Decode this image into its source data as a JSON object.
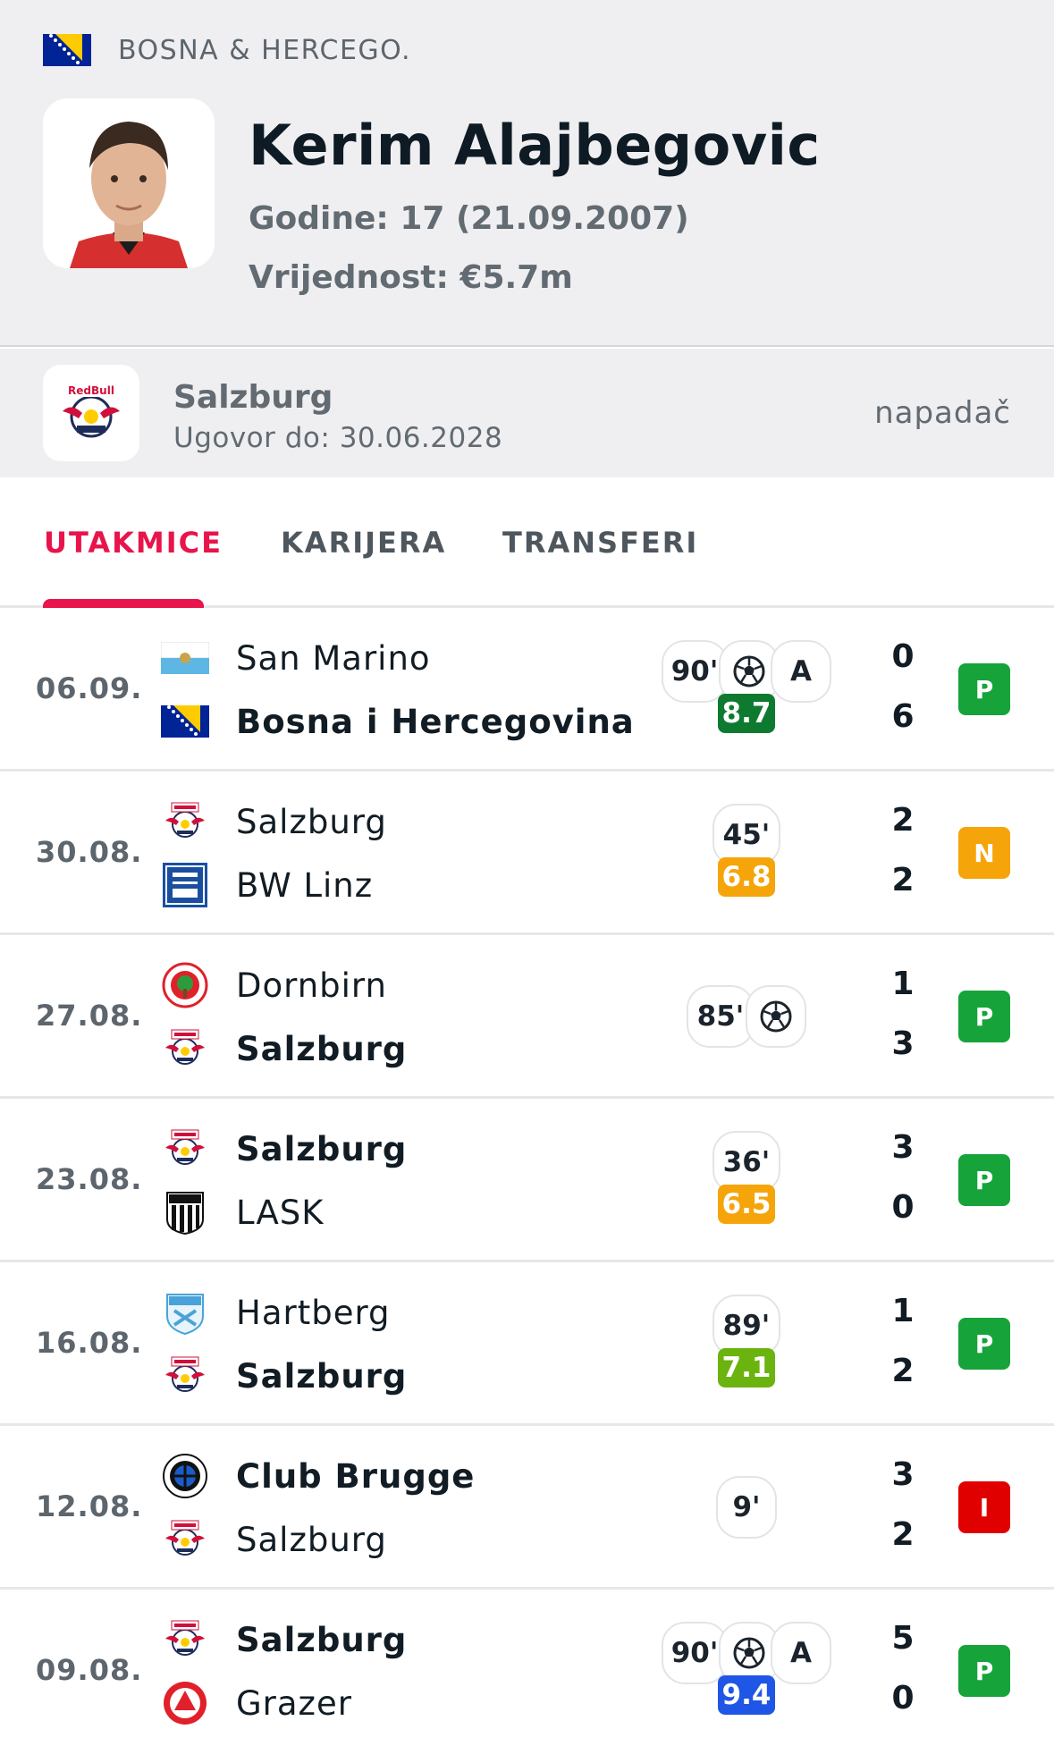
{
  "colors": {
    "accent": "#e8144b",
    "win": "#16a33a",
    "draw": "#f5a50a",
    "loss": "#e00000",
    "rating_dark_green": "#0e7a2f",
    "rating_orange": "#f5a50a",
    "rating_light_green": "#6bb30f",
    "rating_blue": "#1f56e6"
  },
  "header": {
    "country": "BOSNA & HERCEGO.",
    "country_flag": "bosnia-flag",
    "player_name": "Kerim Alajbegovic",
    "age_line": "Godine: 17 (21.09.2007)",
    "value_line": "Vrijednost: €5.7m"
  },
  "club": {
    "name": "Salzburg",
    "contract": "Ugovor do: 30.06.2028",
    "position": "napadač",
    "logo": "salzburg-logo"
  },
  "tabs": [
    {
      "label": "UTAKMICE",
      "active": true
    },
    {
      "label": "KARIJERA",
      "active": false
    },
    {
      "label": "TRANSFERI",
      "active": false
    }
  ],
  "matches": [
    {
      "date": "06.09.",
      "home": "San Marino",
      "home_logo": "san-marino-flag",
      "away": "Bosna i Hercegovina",
      "away_logo": "bosnia-flag",
      "bold": "away",
      "minutes": "90'",
      "goal": true,
      "assist": "A",
      "rating": "8.7",
      "rating_color": "#0e7a2f",
      "home_score": "0",
      "away_score": "6",
      "result": "P",
      "result_color": "#16a33a"
    },
    {
      "date": "30.08.",
      "home": "Salzburg",
      "home_logo": "salzburg-logo",
      "away": "BW Linz",
      "away_logo": "bw-linz-logo",
      "bold": "none",
      "minutes": "45'",
      "goal": false,
      "assist": "",
      "rating": "6.8",
      "rating_color": "#f5a50a",
      "home_score": "2",
      "away_score": "2",
      "result": "N",
      "result_color": "#f5a50a"
    },
    {
      "date": "27.08.",
      "home": "Dornbirn",
      "home_logo": "dornbirn-logo",
      "away": "Salzburg",
      "away_logo": "salzburg-logo",
      "bold": "away",
      "minutes": "85'",
      "goal": true,
      "assist": "",
      "rating": "",
      "rating_color": "",
      "home_score": "1",
      "away_score": "3",
      "result": "P",
      "result_color": "#16a33a"
    },
    {
      "date": "23.08.",
      "home": "Salzburg",
      "home_logo": "salzburg-logo",
      "away": "LASK",
      "away_logo": "lask-logo",
      "bold": "home",
      "minutes": "36'",
      "goal": false,
      "assist": "",
      "rating": "6.5",
      "rating_color": "#f5a50a",
      "home_score": "3",
      "away_score": "0",
      "result": "P",
      "result_color": "#16a33a"
    },
    {
      "date": "16.08.",
      "home": "Hartberg",
      "home_logo": "hartberg-logo",
      "away": "Salzburg",
      "away_logo": "salzburg-logo",
      "bold": "away",
      "minutes": "89'",
      "goal": false,
      "assist": "",
      "rating": "7.1",
      "rating_color": "#6bb30f",
      "home_score": "1",
      "away_score": "2",
      "result": "P",
      "result_color": "#16a33a"
    },
    {
      "date": "12.08.",
      "home": "Club Brugge",
      "home_logo": "club-brugge-logo",
      "away": "Salzburg",
      "away_logo": "salzburg-logo",
      "bold": "home",
      "minutes": "9'",
      "goal": false,
      "assist": "",
      "rating": "",
      "rating_color": "",
      "home_score": "3",
      "away_score": "2",
      "result": "I",
      "result_color": "#e00000"
    },
    {
      "date": "09.08.",
      "home": "Salzburg",
      "home_logo": "salzburg-logo",
      "away": "Grazer",
      "away_logo": "grazer-logo",
      "bold": "home",
      "minutes": "90'",
      "goal": true,
      "assist": "A",
      "rating": "9.4",
      "rating_color": "#1f56e6",
      "home_score": "5",
      "away_score": "0",
      "result": "P",
      "result_color": "#16a33a"
    }
  ]
}
